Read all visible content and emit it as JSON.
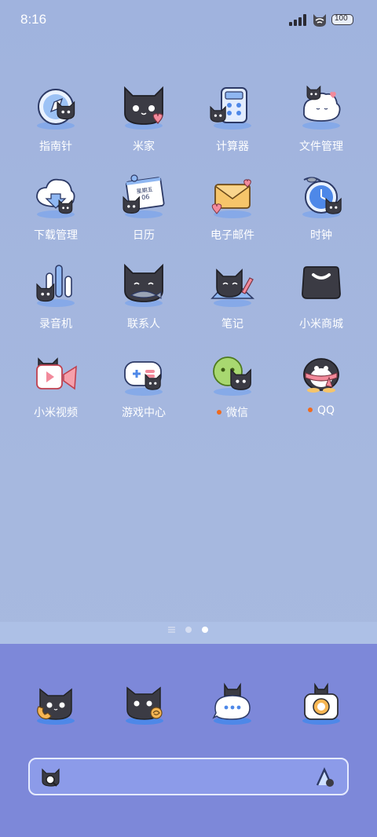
{
  "status_bar": {
    "time": "8:16",
    "battery_level": "100"
  },
  "apps": [
    {
      "label": "指南针",
      "icon": "compass-icon"
    },
    {
      "label": "米家",
      "icon": "mijia-icon"
    },
    {
      "label": "计算器",
      "icon": "calculator-icon"
    },
    {
      "label": "文件管理",
      "icon": "file-manager-icon"
    },
    {
      "label": "下载管理",
      "icon": "download-manager-icon"
    },
    {
      "label": "日历",
      "icon": "calendar-icon",
      "calendar_weekday": "星期五",
      "calendar_day": "06"
    },
    {
      "label": "电子邮件",
      "icon": "email-icon"
    },
    {
      "label": "时钟",
      "icon": "clock-icon"
    },
    {
      "label": "录音机",
      "icon": "recorder-icon"
    },
    {
      "label": "联系人",
      "icon": "contacts-icon"
    },
    {
      "label": "笔记",
      "icon": "notes-icon"
    },
    {
      "label": "小米商城",
      "icon": "mi-store-icon"
    },
    {
      "label": "小米视频",
      "icon": "mi-video-icon"
    },
    {
      "label": "游戏中心",
      "icon": "game-center-icon"
    },
    {
      "label": "微信",
      "icon": "wechat-icon",
      "has_notification": true
    },
    {
      "label": "QQ",
      "icon": "qq-icon",
      "has_notification": true
    }
  ],
  "page_indicator": {
    "pages": 2,
    "current": 2
  },
  "dock": [
    {
      "icon": "phone-icon"
    },
    {
      "icon": "browser-icon"
    },
    {
      "icon": "messages-icon"
    },
    {
      "icon": "camera-icon"
    }
  ],
  "search_bar": {
    "left_icon": "search-cat-icon",
    "right_icon": "assistant-icon"
  },
  "colors": {
    "wallpaper": "#a3b6de",
    "dock": "#7d88d9",
    "search_bar": "#8c9be9",
    "notification_dot": "#f06a1d"
  }
}
